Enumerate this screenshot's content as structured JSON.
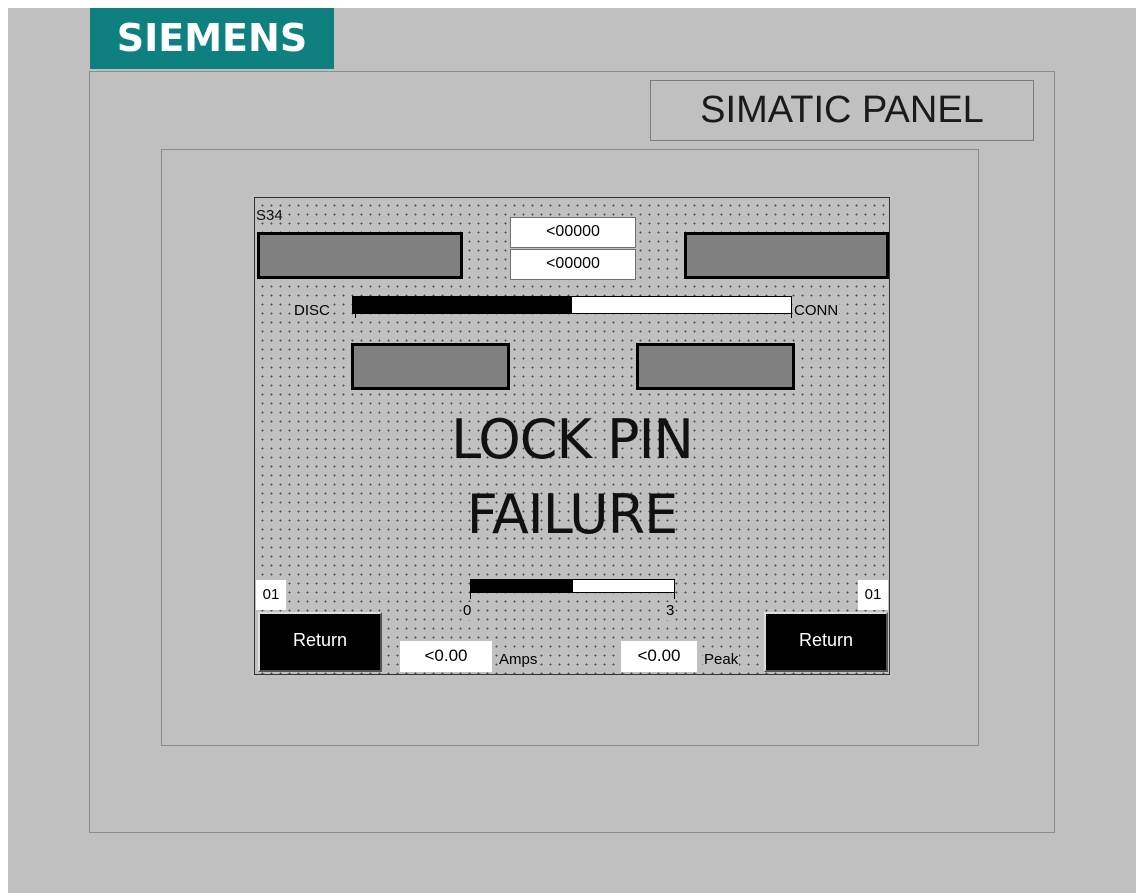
{
  "brand": {
    "logo_text": "SIEMENS",
    "model_label": "SIMATIC PANEL",
    "logo_color": "#0f8080"
  },
  "screen": {
    "station_id": "S34",
    "top_values": [
      "<00000",
      "<00000"
    ],
    "position_bar": {
      "left_label": "DISC",
      "right_label": "CONN",
      "fill_fraction": 0.5
    },
    "status_lines": [
      "LOCK PIN",
      "FAILURE"
    ],
    "current_bar": {
      "min_label": "0",
      "max_label": "3",
      "fill_fraction": 0.5
    },
    "left_counter": "01",
    "right_counter": "01",
    "left_button": "Return",
    "right_button": "Return",
    "amps_value": "<0.00",
    "amps_unit": "Amps",
    "peak_value": "<0.00",
    "peak_unit": "Peak"
  },
  "colors": {
    "indicator": "#808080",
    "panel_bg": "#c0c0c0",
    "button_bg": "#000000"
  }
}
